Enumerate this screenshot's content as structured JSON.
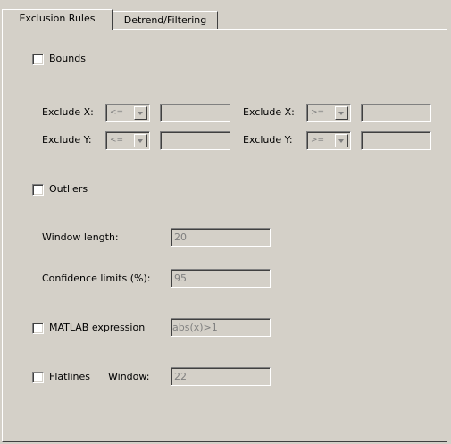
{
  "tabs": {
    "exclusion": "Exclusion Rules",
    "detrend": "Detrend/Filtering"
  },
  "bounds": {
    "label": "Bounds",
    "exclude_x1": {
      "label": "Exclude X:",
      "op": "<=",
      "value": ""
    },
    "exclude_x2": {
      "label": "Exclude X:",
      "op": ">=",
      "value": ""
    },
    "exclude_y1": {
      "label": "Exclude Y:",
      "op": "<=",
      "value": ""
    },
    "exclude_y2": {
      "label": "Exclude Y:",
      "op": ">=",
      "value": ""
    }
  },
  "outliers": {
    "label": "Outliers",
    "window_length_label": "Window length:",
    "window_length_value": "20",
    "confidence_label": "Confidence limits (%):",
    "confidence_value": "95"
  },
  "matlab": {
    "label": "MATLAB expression",
    "value": "abs(x)>1"
  },
  "flatlines": {
    "label": "Flatlines",
    "window_label": "Window:",
    "window_value": "22"
  }
}
